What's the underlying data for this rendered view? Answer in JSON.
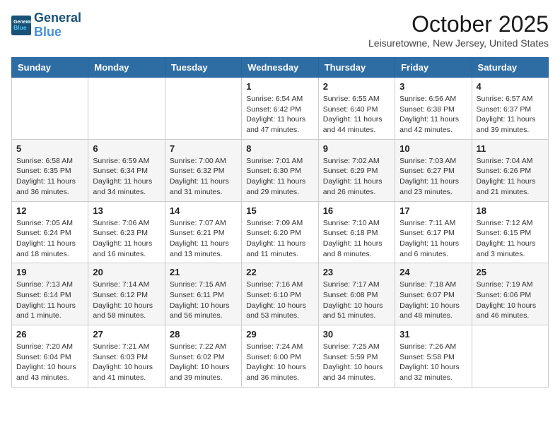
{
  "header": {
    "logo_line1": "General",
    "logo_line2": "Blue",
    "month_title": "October 2025",
    "location": "Leisuretowne, New Jersey, United States"
  },
  "weekdays": [
    "Sunday",
    "Monday",
    "Tuesday",
    "Wednesday",
    "Thursday",
    "Friday",
    "Saturday"
  ],
  "weeks": [
    [
      {
        "day": "",
        "info": ""
      },
      {
        "day": "",
        "info": ""
      },
      {
        "day": "",
        "info": ""
      },
      {
        "day": "1",
        "info": "Sunrise: 6:54 AM\nSunset: 6:42 PM\nDaylight: 11 hours\nand 47 minutes."
      },
      {
        "day": "2",
        "info": "Sunrise: 6:55 AM\nSunset: 6:40 PM\nDaylight: 11 hours\nand 44 minutes."
      },
      {
        "day": "3",
        "info": "Sunrise: 6:56 AM\nSunset: 6:38 PM\nDaylight: 11 hours\nand 42 minutes."
      },
      {
        "day": "4",
        "info": "Sunrise: 6:57 AM\nSunset: 6:37 PM\nDaylight: 11 hours\nand 39 minutes."
      }
    ],
    [
      {
        "day": "5",
        "info": "Sunrise: 6:58 AM\nSunset: 6:35 PM\nDaylight: 11 hours\nand 36 minutes."
      },
      {
        "day": "6",
        "info": "Sunrise: 6:59 AM\nSunset: 6:34 PM\nDaylight: 11 hours\nand 34 minutes."
      },
      {
        "day": "7",
        "info": "Sunrise: 7:00 AM\nSunset: 6:32 PM\nDaylight: 11 hours\nand 31 minutes."
      },
      {
        "day": "8",
        "info": "Sunrise: 7:01 AM\nSunset: 6:30 PM\nDaylight: 11 hours\nand 29 minutes."
      },
      {
        "day": "9",
        "info": "Sunrise: 7:02 AM\nSunset: 6:29 PM\nDaylight: 11 hours\nand 26 minutes."
      },
      {
        "day": "10",
        "info": "Sunrise: 7:03 AM\nSunset: 6:27 PM\nDaylight: 11 hours\nand 23 minutes."
      },
      {
        "day": "11",
        "info": "Sunrise: 7:04 AM\nSunset: 6:26 PM\nDaylight: 11 hours\nand 21 minutes."
      }
    ],
    [
      {
        "day": "12",
        "info": "Sunrise: 7:05 AM\nSunset: 6:24 PM\nDaylight: 11 hours\nand 18 minutes."
      },
      {
        "day": "13",
        "info": "Sunrise: 7:06 AM\nSunset: 6:23 PM\nDaylight: 11 hours\nand 16 minutes."
      },
      {
        "day": "14",
        "info": "Sunrise: 7:07 AM\nSunset: 6:21 PM\nDaylight: 11 hours\nand 13 minutes."
      },
      {
        "day": "15",
        "info": "Sunrise: 7:09 AM\nSunset: 6:20 PM\nDaylight: 11 hours\nand 11 minutes."
      },
      {
        "day": "16",
        "info": "Sunrise: 7:10 AM\nSunset: 6:18 PM\nDaylight: 11 hours\nand 8 minutes."
      },
      {
        "day": "17",
        "info": "Sunrise: 7:11 AM\nSunset: 6:17 PM\nDaylight: 11 hours\nand 6 minutes."
      },
      {
        "day": "18",
        "info": "Sunrise: 7:12 AM\nSunset: 6:15 PM\nDaylight: 11 hours\nand 3 minutes."
      }
    ],
    [
      {
        "day": "19",
        "info": "Sunrise: 7:13 AM\nSunset: 6:14 PM\nDaylight: 11 hours\nand 1 minute."
      },
      {
        "day": "20",
        "info": "Sunrise: 7:14 AM\nSunset: 6:12 PM\nDaylight: 10 hours\nand 58 minutes."
      },
      {
        "day": "21",
        "info": "Sunrise: 7:15 AM\nSunset: 6:11 PM\nDaylight: 10 hours\nand 56 minutes."
      },
      {
        "day": "22",
        "info": "Sunrise: 7:16 AM\nSunset: 6:10 PM\nDaylight: 10 hours\nand 53 minutes."
      },
      {
        "day": "23",
        "info": "Sunrise: 7:17 AM\nSunset: 6:08 PM\nDaylight: 10 hours\nand 51 minutes."
      },
      {
        "day": "24",
        "info": "Sunrise: 7:18 AM\nSunset: 6:07 PM\nDaylight: 10 hours\nand 48 minutes."
      },
      {
        "day": "25",
        "info": "Sunrise: 7:19 AM\nSunset: 6:06 PM\nDaylight: 10 hours\nand 46 minutes."
      }
    ],
    [
      {
        "day": "26",
        "info": "Sunrise: 7:20 AM\nSunset: 6:04 PM\nDaylight: 10 hours\nand 43 minutes."
      },
      {
        "day": "27",
        "info": "Sunrise: 7:21 AM\nSunset: 6:03 PM\nDaylight: 10 hours\nand 41 minutes."
      },
      {
        "day": "28",
        "info": "Sunrise: 7:22 AM\nSunset: 6:02 PM\nDaylight: 10 hours\nand 39 minutes."
      },
      {
        "day": "29",
        "info": "Sunrise: 7:24 AM\nSunset: 6:00 PM\nDaylight: 10 hours\nand 36 minutes."
      },
      {
        "day": "30",
        "info": "Sunrise: 7:25 AM\nSunset: 5:59 PM\nDaylight: 10 hours\nand 34 minutes."
      },
      {
        "day": "31",
        "info": "Sunrise: 7:26 AM\nSunset: 5:58 PM\nDaylight: 10 hours\nand 32 minutes."
      },
      {
        "day": "",
        "info": ""
      }
    ]
  ]
}
